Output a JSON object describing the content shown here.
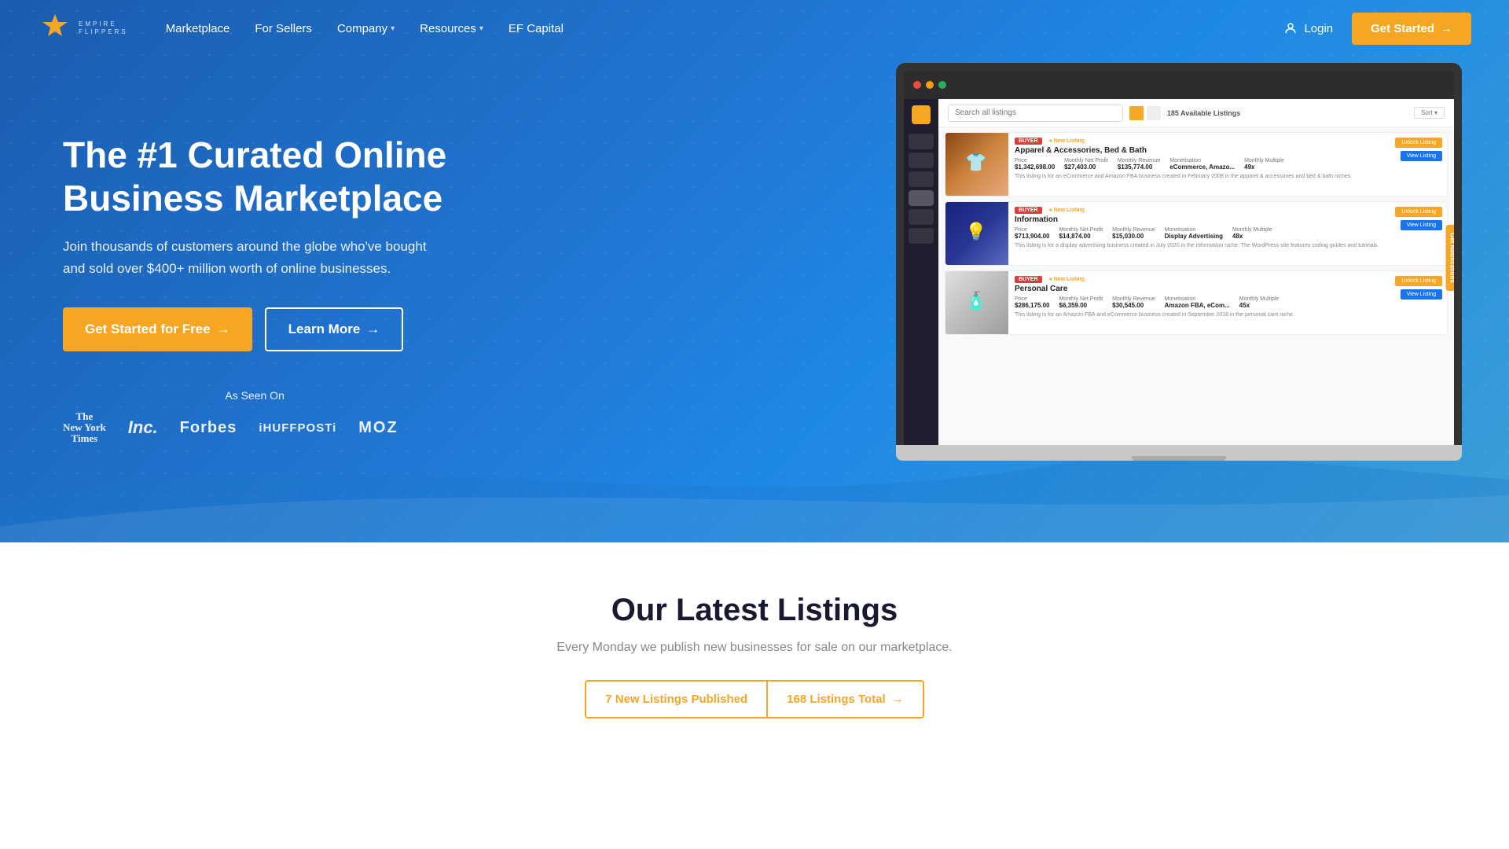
{
  "header": {
    "logo_line1": "EMPIRE",
    "logo_line2": "FLIPPERS",
    "nav": [
      {
        "label": "Marketplace",
        "has_dropdown": false
      },
      {
        "label": "For Sellers",
        "has_dropdown": false
      },
      {
        "label": "Company",
        "has_dropdown": true
      },
      {
        "label": "Resources",
        "has_dropdown": true
      },
      {
        "label": "EF Capital",
        "has_dropdown": false
      }
    ],
    "login_label": "Login",
    "get_started_label": "Get Started"
  },
  "hero": {
    "title_line1": "The #1 Curated Online",
    "title_line2": "Business Marketplace",
    "subtitle": "Join thousands of customers around the globe who've bought and sold over $400+ million worth of online businesses.",
    "cta_primary": "Get Started for Free",
    "cta_secondary": "Learn More",
    "as_seen_on": "As Seen On",
    "press": [
      "The New York Times",
      "Inc.",
      "Forbes",
      "iHUFFPOSTi",
      "MOZ"
    ]
  },
  "marketplace_ui": {
    "search_placeholder": "Search all listings",
    "available_label": "185 Available Listings",
    "listings": [
      {
        "tag": "BUYER",
        "is_new": true,
        "title": "Apparel & Accessories, Bed & Bath",
        "price": "$1,342,698.00",
        "net_profit": "$27,403.00",
        "revenue": "$135,774.00",
        "monetization": "eCommerce, Amazo...",
        "multiple": "49x",
        "desc": "This listing is for an eCommerce and Amazon FBA business created in February 2008 in the apparel & accessories and bed & bath niches.",
        "img_class": "ui-listing-img-1"
      },
      {
        "tag": "BUYER",
        "is_new": true,
        "title": "Information",
        "price": "$713,904.00",
        "net_profit": "$14,874.00",
        "revenue": "$15,030.00",
        "monetization": "Display Advertising",
        "multiple": "48x",
        "desc": "This listing is for a display advertising business created in July 2020 in the information niche. The WordPress site features coding guides and tutorials.",
        "img_class": "ui-listing-img-2"
      },
      {
        "tag": "BUYER",
        "is_new": true,
        "title": "Personal Care",
        "price": "$286,175.00",
        "net_profit": "$6,359.00",
        "revenue": "$30,545.00",
        "monetization": "Amazon FBA, eCom...",
        "multiple": "45x",
        "desc": "This listing is for an Amazon FBA and eCommerce business created in September 2018 in the personal care niche.",
        "img_class": "ui-listing-img-3"
      }
    ],
    "unlock_label": "Unlock Listing",
    "view_label": "View Listing",
    "notification_tab": "Get Notifications"
  },
  "listings_section": {
    "title": "Our Latest Listings",
    "subtitle": "Every Monday we publish new businesses for sale on our marketplace.",
    "new_count": "7 New Listings Published",
    "total_count": "168 Listings Total"
  }
}
